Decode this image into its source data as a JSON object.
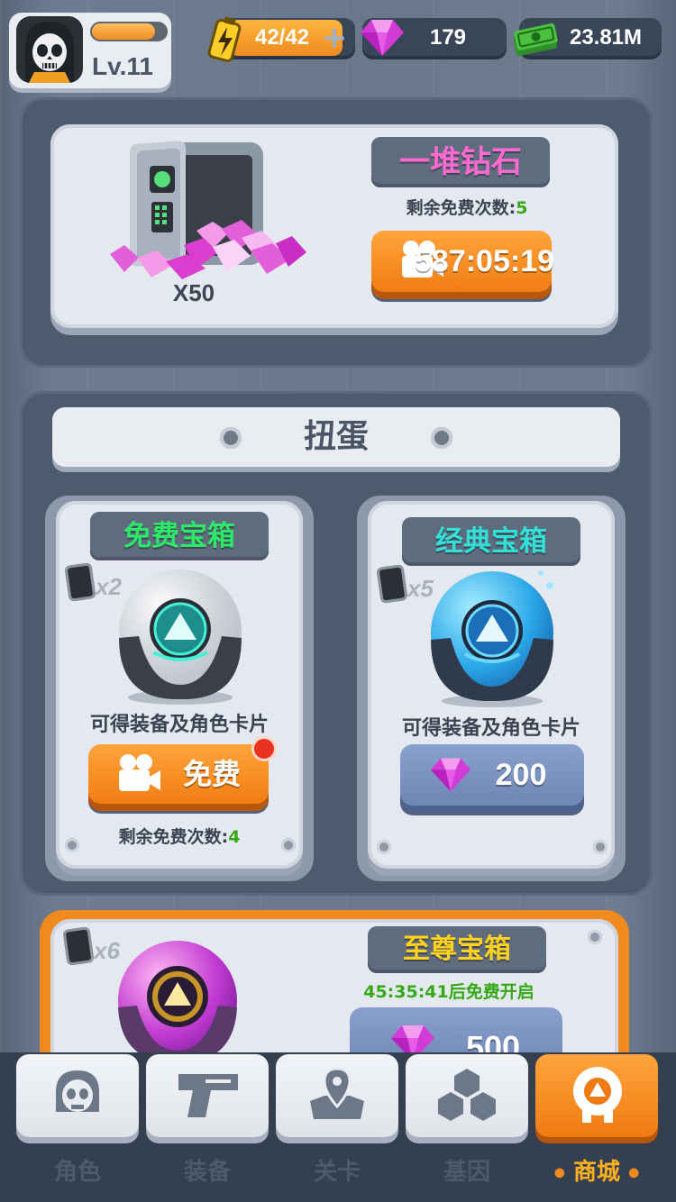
{
  "header": {
    "level": "Lv.11",
    "xp_fraction": 0.85,
    "energy": "42/42",
    "gems": "179",
    "cash": "23.81M"
  },
  "diamond_pile": {
    "title": "一堆钻石",
    "quantity": "X50",
    "remaining_label": "剩余免费次数:",
    "remaining_count": "5",
    "timer": "587:05:19"
  },
  "gacha": {
    "title": "扭蛋",
    "free_chest": {
      "title": "免费宝箱",
      "card_count": "x2",
      "desc": "可得装备及角色卡片",
      "button_label": "免费",
      "remaining_label": "剩余免费次数:",
      "remaining_count": "4"
    },
    "classic_chest": {
      "title": "经典宝箱",
      "card_count": "x5",
      "desc": "可得装备及角色卡片",
      "price": "200"
    },
    "supreme_chest": {
      "title": "至尊宝箱",
      "card_count": "x6",
      "free_timer": "45:35:41后免费开启",
      "price": "500"
    }
  },
  "nav": {
    "items": [
      {
        "label": "角色",
        "icon": "skull-icon"
      },
      {
        "label": "装备",
        "icon": "gun-icon"
      },
      {
        "label": "关卡",
        "icon": "map-pin-icon"
      },
      {
        "label": "基因",
        "icon": "hexagon-icon"
      },
      {
        "label": "商城",
        "icon": "shop-icon",
        "active": true
      }
    ]
  },
  "colors": {
    "accent_orange": "#f08a1e",
    "title_green": "#2ee86a",
    "title_cyan": "#33e0d8",
    "title_pink": "#ff6ad2",
    "title_gold": "#ffd21f"
  }
}
